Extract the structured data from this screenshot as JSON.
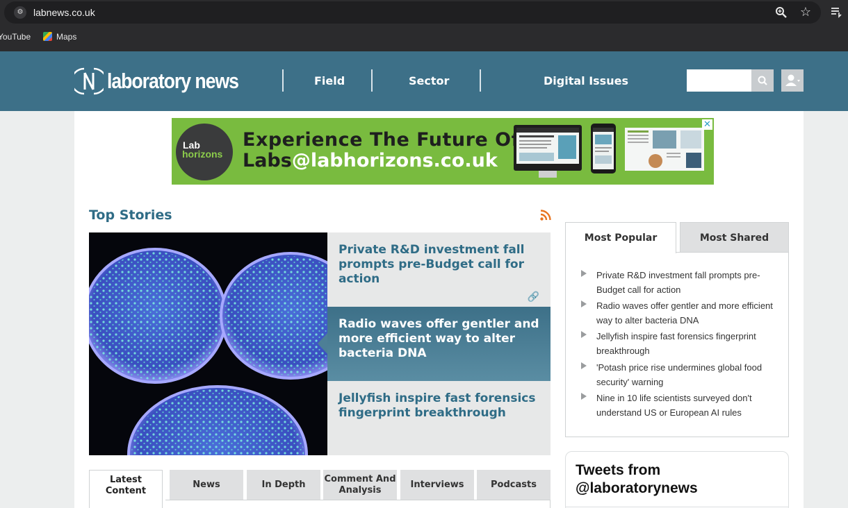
{
  "browser": {
    "url": "labnews.co.uk",
    "bookmarks": [
      {
        "label": "YouTube"
      },
      {
        "label": "Maps"
      }
    ]
  },
  "header": {
    "logo_text": "laboratory news",
    "nav": [
      "Field",
      "Sector",
      "Digital Issues"
    ],
    "search_placeholder": ""
  },
  "banner": {
    "logo_line1": "Lab",
    "logo_line2": "horizons",
    "headline_line1": "Experience The Future Of",
    "headline_line2_dark": "Labs",
    "headline_line2_light": "@labhorizons.co.uk",
    "close_label": "✕",
    "background_color": "#79bb3f"
  },
  "top_stories": {
    "title": "Top Stories",
    "stories": [
      "Private R&D investment fall prompts pre-Budget call for action",
      "Radio waves offer gentler and more efficient way to alter bacteria DNA",
      "Jellyfish inspire fast forensics fingerprint breakthrough"
    ],
    "active_index": 1
  },
  "content_tabs": [
    "Latest Content",
    "News",
    "In Depth",
    "Comment And Analysis",
    "Interviews",
    "Podcasts"
  ],
  "popular": {
    "tabs": [
      "Most Popular",
      "Most Shared"
    ],
    "items": [
      "Private R&D investment fall prompts pre-Budget call for action",
      "Radio waves offer gentler and more efficient way to alter bacteria DNA",
      "Jellyfish inspire fast forensics fingerprint breakthrough",
      "'Potash price rise undermines global food security' warning",
      "Nine in 10 life scientists surveyed don't understand US or European AI rules"
    ]
  },
  "tweets": {
    "title": "Tweets from @laboratorynews"
  },
  "colors": {
    "header": "#3d7088",
    "accent_text": "#2f6c86",
    "rss": "#e8741f"
  }
}
